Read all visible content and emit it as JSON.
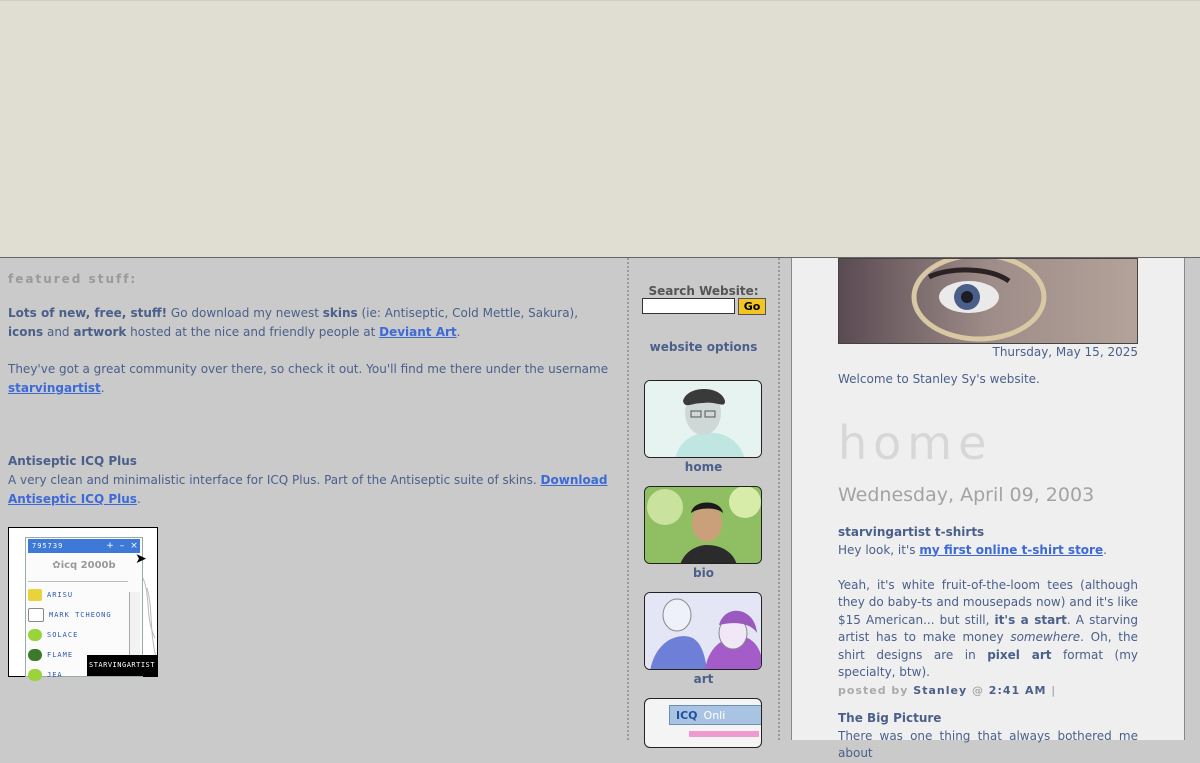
{
  "featured": {
    "heading": "featured stuff:",
    "intro_bold": "Lots of new, free, stuff!",
    "intro_1": " Go download my newest ",
    "skins": "skins",
    "intro_2": " (ie: Antiseptic, Cold Mettle, Sakura), ",
    "icons": "icons",
    "intro_3": " and ",
    "artwork": "artwork",
    "intro_4": " hosted at the nice and friendly people at ",
    "deviant_link": "Deviant Art",
    "period": ".",
    "community_text": "They've got a great community over there, so check it out. You'll find me there under the username ",
    "username_link": "starvingartist",
    "icq_title": "Antiseptic ICQ Plus",
    "icq_desc": "A very clean and minimalistic interface for ICQ Plus. Part of the Antiseptic suite of skins. ",
    "icq_link": "Download Antiseptic ICQ Plus"
  },
  "icq_thumb": {
    "uin": "795739",
    "logo": "icq 2000b",
    "contacts": [
      "ARISU",
      "MARK TCHEONG",
      "SOLACE",
      "FLAME",
      "JEA"
    ],
    "tag": "STARVINGARTIST"
  },
  "sidebar": {
    "search_label": "Search Website:",
    "search_value": "",
    "go_label": "Go",
    "options_title": "website options",
    "nav": [
      {
        "label": "home"
      },
      {
        "label": "bio"
      },
      {
        "label": "art"
      }
    ],
    "icq_nav_text": "ICQ",
    "icq_nav_status": "Onli"
  },
  "main": {
    "date_now": "Thursday, May 15, 2025",
    "welcome": "Welcome to Stanley Sy's website.",
    "section_title": "home",
    "post_date": "Wednesday, April 09, 2003",
    "post1": {
      "title": "starvingartist t-shirts",
      "line1": "Hey look, it's ",
      "link": "my first online t-shirt store",
      "line1_end": ".",
      "p2a": "Yeah, it's white fruit-of-the-loom tees (although they do baby-ts and mousepads now) and it's like $15 American... but still, ",
      "p2b": "it's a start",
      "p2c": ". A starving artist has to make money ",
      "p2d": "somewhere",
      "p2e": ". Oh, the shirt designs are in ",
      "p2f": "pixel art",
      "p2g": " format (my specialty, btw).",
      "posted_by": "posted by ",
      "author": "Stanley",
      "at": " @ ",
      "time": "2:41 AM",
      "sep": " |"
    },
    "post2": {
      "title": "The Big Picture",
      "text": "There was one thing that always bothered me about"
    }
  }
}
